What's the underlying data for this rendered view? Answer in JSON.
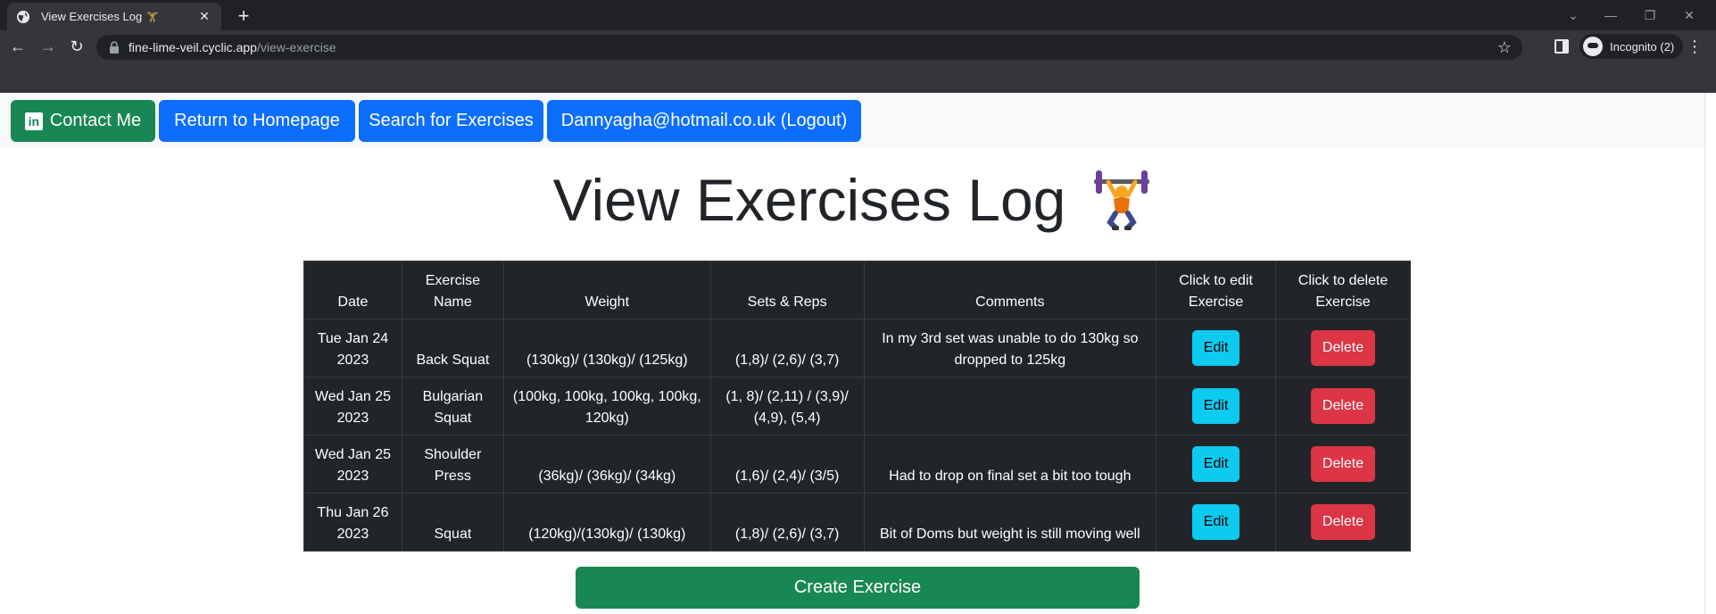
{
  "browser": {
    "tab_title": "View Exercises Log",
    "tab_emoji": "🏋",
    "url_host": "fine-lime-veil.cyclic.app",
    "url_path": "/view-exercise",
    "profile_label": "Incognito (2)"
  },
  "nav": {
    "contact": "Contact Me",
    "linkedin_glyph": "in",
    "home": "Return to Homepage",
    "search": "Search for Exercises",
    "logout": "Dannyagha@hotmail.co.uk (Logout)"
  },
  "page": {
    "title": "View Exercises Log",
    "create_label": "Create Exercise"
  },
  "table": {
    "headers": [
      "Date",
      "Exercise Name",
      "Weight",
      "Sets & Reps",
      "Comments",
      "Click to edit Exercise",
      "Click to delete Exercise"
    ],
    "rows": [
      {
        "date": "Tue Jan 24 2023",
        "name": "Back Squat",
        "weight": "(130kg)/ (130kg)/ (125kg)",
        "sets": "(1,8)/ (2,6)/ (3,7)",
        "comments": "In my 3rd set was unable to do 130kg so dropped to 125kg",
        "edit": "Edit",
        "delete": "Delete"
      },
      {
        "date": "Wed Jan 25 2023",
        "name": "Bulgarian Squat",
        "weight": "(100kg, 100kg, 100kg, 100kg, 120kg)",
        "sets": "(1, 8)/ (2,11) / (3,9)/ (4,9), (5,4)",
        "comments": "",
        "edit": "Edit",
        "delete": "Delete"
      },
      {
        "date": "Wed Jan 25 2023",
        "name": "Shoulder Press",
        "weight": "(36kg)/ (36kg)/ (34kg)",
        "sets": "(1,6)/ (2,4)/ (3/5)",
        "comments": "Had to drop on final set a bit too tough",
        "edit": "Edit",
        "delete": "Delete"
      },
      {
        "date": "Thu Jan 26 2023",
        "name": "Squat",
        "weight": "(120kg)/(130kg)/ (130kg)",
        "sets": "(1,8)/ (2,6)/ (3,7)",
        "comments": "Bit of Doms but weight is still moving well",
        "edit": "Edit",
        "delete": "Delete"
      }
    ]
  },
  "colors": {
    "success": "#198754",
    "primary": "#0d6efd",
    "info": "#0dcaf0",
    "danger": "#dc3545",
    "table_dark": "#212529"
  },
  "icons": [
    "globe-icon",
    "close-icon",
    "plus-icon",
    "back-icon",
    "forward-icon",
    "reload-icon",
    "lock-icon",
    "star-icon",
    "side-panel-icon",
    "incognito-icon",
    "kebab-icon",
    "linkedin-icon",
    "weightlifter-icon"
  ]
}
